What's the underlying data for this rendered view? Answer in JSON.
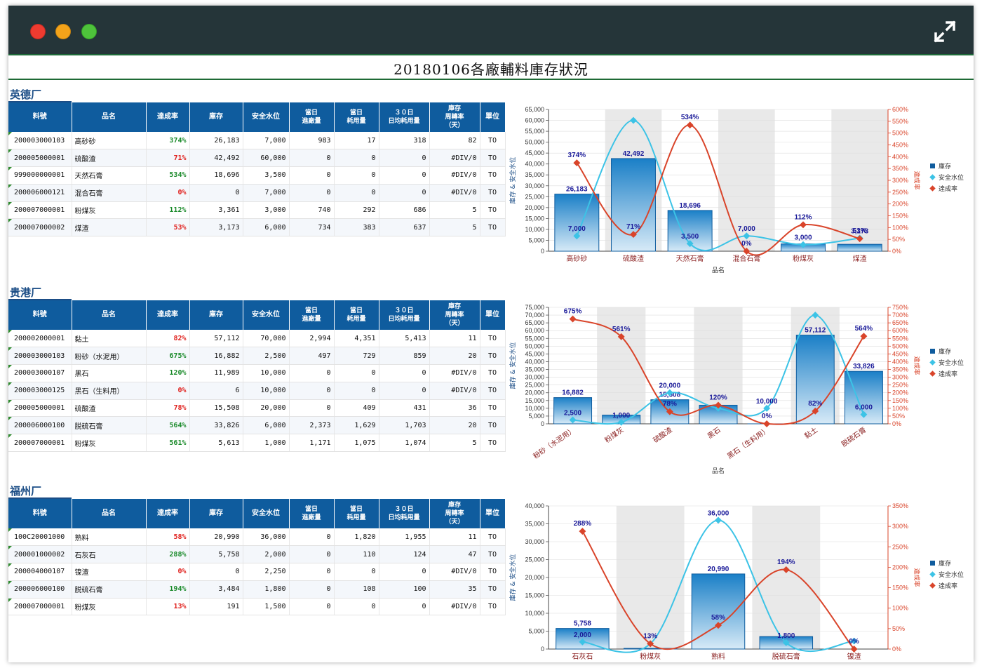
{
  "window": {
    "expand_icon": "expand-arrows-icon"
  },
  "page_title": "20180106各廠輔料庫存狀況",
  "table_headers": [
    "料號",
    "品名",
    "達成率",
    "庫存",
    "安全水位",
    "當日\n進廠量",
    "當日\n耗用量",
    "３０日\n日均耗用量",
    "庫存\n周轉率\n（天）",
    "單位"
  ],
  "colors": {
    "bar": "#1a7fc7",
    "inventory_line": "#3cc3e6",
    "rate_line": "#d9442a",
    "header": "#0f5c9e",
    "good": "#1a8a2a",
    "bad": "#e0201c"
  },
  "plants": [
    {
      "name": "英德厂",
      "rows": [
        {
          "code": "200003000103",
          "name": "高砂砂",
          "rate": "374%",
          "rate_good": true,
          "stock": "26,183",
          "safety": "7,000",
          "in": "983",
          "use": "17",
          "avg": "318",
          "turn": "82",
          "unit": "TO"
        },
        {
          "code": "200005000001",
          "name": "硫酸渣",
          "rate": "71%",
          "rate_good": false,
          "stock": "42,492",
          "safety": "60,000",
          "in": "0",
          "use": "0",
          "avg": "0",
          "turn": "#DIV/0",
          "unit": "TO"
        },
        {
          "code": "999000000001",
          "name": "天然石膏",
          "rate": "534%",
          "rate_good": true,
          "stock": "18,696",
          "safety": "3,500",
          "in": "0",
          "use": "0",
          "avg": "0",
          "turn": "#DIV/0",
          "unit": "TO"
        },
        {
          "code": "200006000121",
          "name": "混合石膏",
          "rate": "0%",
          "rate_good": false,
          "stock": "0",
          "safety": "7,000",
          "in": "0",
          "use": "0",
          "avg": "0",
          "turn": "#DIV/0",
          "unit": "TO"
        },
        {
          "code": "200007000001",
          "name": "粉煤灰",
          "rate": "112%",
          "rate_good": true,
          "stock": "3,361",
          "safety": "3,000",
          "in": "740",
          "use": "292",
          "avg": "686",
          "turn": "5",
          "unit": "TO"
        },
        {
          "code": "200007000002",
          "name": "煤渣",
          "rate": "53%",
          "rate_good": false,
          "stock": "3,173",
          "safety": "6,000",
          "in": "734",
          "use": "383",
          "avg": "637",
          "turn": "5",
          "unit": "TO"
        }
      ]
    },
    {
      "name": "贵港厂",
      "rows": [
        {
          "code": "200002000001",
          "name": "黏土",
          "rate": "82%",
          "rate_good": false,
          "stock": "57,112",
          "safety": "70,000",
          "in": "2,994",
          "use": "4,351",
          "avg": "5,413",
          "turn": "11",
          "unit": "TO"
        },
        {
          "code": "200003000103",
          "name": "粉砂（水泥用）",
          "rate": "675%",
          "rate_good": true,
          "stock": "16,882",
          "safety": "2,500",
          "in": "497",
          "use": "729",
          "avg": "859",
          "turn": "20",
          "unit": "TO"
        },
        {
          "code": "200003000107",
          "name": "黑石",
          "rate": "120%",
          "rate_good": true,
          "stock": "11,989",
          "safety": "10,000",
          "in": "0",
          "use": "0",
          "avg": "0",
          "turn": "#DIV/0",
          "unit": "TO"
        },
        {
          "code": "200003000125",
          "name": "黑石（生料用）",
          "rate": "0%",
          "rate_good": false,
          "stock": "6",
          "safety": "10,000",
          "in": "0",
          "use": "0",
          "avg": "0",
          "turn": "#DIV/0",
          "unit": "TO"
        },
        {
          "code": "200005000001",
          "name": "硫酸渣",
          "rate": "78%",
          "rate_good": false,
          "stock": "15,508",
          "safety": "20,000",
          "in": "0",
          "use": "409",
          "avg": "431",
          "turn": "36",
          "unit": "TO"
        },
        {
          "code": "200006000100",
          "name": "脱硫石膏",
          "rate": "564%",
          "rate_good": true,
          "stock": "33,826",
          "safety": "6,000",
          "in": "2,373",
          "use": "1,629",
          "avg": "1,703",
          "turn": "20",
          "unit": "TO"
        },
        {
          "code": "200007000001",
          "name": "粉煤灰",
          "rate": "561%",
          "rate_good": true,
          "stock": "5,613",
          "safety": "1,000",
          "in": "1,171",
          "use": "1,075",
          "avg": "1,074",
          "turn": "5",
          "unit": "TO"
        }
      ]
    },
    {
      "name": "福州厂",
      "rows": [
        {
          "code": "100C20001000",
          "name": "熟料",
          "rate": "58%",
          "rate_good": false,
          "stock": "20,990",
          "safety": "36,000",
          "in": "0",
          "use": "1,820",
          "avg": "1,955",
          "turn": "11",
          "unit": "TO"
        },
        {
          "code": "200001000002",
          "name": "石灰石",
          "rate": "288%",
          "rate_good": true,
          "stock": "5,758",
          "safety": "2,000",
          "in": "0",
          "use": "110",
          "avg": "124",
          "turn": "47",
          "unit": "TO"
        },
        {
          "code": "200004000107",
          "name": "镍渣",
          "rate": "0%",
          "rate_good": false,
          "stock": "0",
          "safety": "2,250",
          "in": "0",
          "use": "0",
          "avg": "0",
          "turn": "#DIV/0",
          "unit": "TO"
        },
        {
          "code": "200006000100",
          "name": "脱硫石膏",
          "rate": "194%",
          "rate_good": true,
          "stock": "3,484",
          "safety": "1,800",
          "in": "0",
          "use": "108",
          "avg": "100",
          "turn": "35",
          "unit": "TO"
        },
        {
          "code": "200007000001",
          "name": "粉煤灰",
          "rate": "13%",
          "rate_good": false,
          "stock": "191",
          "safety": "1,500",
          "in": "0",
          "use": "0",
          "avg": "0",
          "turn": "#DIV/0",
          "unit": "TO"
        }
      ]
    }
  ],
  "chart_data": [
    {
      "type": "bar",
      "categories": [
        "高砂砂",
        "硫酸渣",
        "天然石膏",
        "混合石膏",
        "粉煤灰",
        "煤渣"
      ],
      "xlabel": "品名",
      "ylabel": "庫存 & 安全水位",
      "y2label": "達成率",
      "ylim": [
        0,
        65000
      ],
      "ystep": 5000,
      "y2lim": [
        0,
        600
      ],
      "y2step": 50,
      "rotate_labels": false,
      "series": [
        {
          "name": "庫存",
          "kind": "bar",
          "values": [
            26183,
            42492,
            18696,
            0,
            3361,
            3173
          ],
          "labels": [
            "26,183",
            "42,492",
            "18,696",
            "",
            "",
            ""
          ]
        },
        {
          "name": "安全水位",
          "kind": "line",
          "values": [
            7000,
            60000,
            3500,
            7000,
            3000,
            6000
          ],
          "labels": [
            "7,000",
            "",
            "3,500",
            "7,000",
            "3,000",
            "3,173"
          ]
        },
        {
          "name": "達成率",
          "kind": "line",
          "axis": "right",
          "values": [
            374,
            71,
            534,
            0,
            112,
            53
          ],
          "labels": [
            "374%",
            "71%",
            "534%",
            "0%",
            "112%",
            "53%"
          ]
        }
      ],
      "legend": [
        "庫存",
        "安全水位",
        "達成率"
      ]
    },
    {
      "type": "bar",
      "categories": [
        "粉砂（水泥用）",
        "粉煤灰",
        "硫酸渣",
        "黑石",
        "黑石（生料用）",
        "黏土",
        "脱硫石膏"
      ],
      "xlabel": "品名",
      "ylabel": "庫存 & 安全水位",
      "y2label": "達成率",
      "ylim": [
        0,
        75000
      ],
      "ystep": 5000,
      "y2lim": [
        0,
        750
      ],
      "y2step": 50,
      "rotate_labels": true,
      "series": [
        {
          "name": "庫存",
          "kind": "bar",
          "values": [
            16882,
            5613,
            15508,
            11989,
            6,
            57112,
            33826
          ],
          "labels": [
            "16,882",
            "",
            "15,508",
            "",
            "",
            "57,112",
            "33,826"
          ]
        },
        {
          "name": "安全水位",
          "kind": "line",
          "values": [
            2500,
            1000,
            20000,
            10000,
            10000,
            70000,
            6000
          ],
          "labels": [
            "2,500",
            "1,000",
            "20,000",
            "",
            "10,000",
            "",
            "6,000"
          ]
        },
        {
          "name": "達成率",
          "kind": "line",
          "axis": "right",
          "values": [
            675,
            561,
            78,
            120,
            0,
            82,
            564
          ],
          "labels": [
            "675%",
            "561%",
            "78%",
            "120%",
            "0%",
            "82%",
            "564%"
          ]
        }
      ],
      "legend": [
        "庫存",
        "安全水位",
        "達成率"
      ]
    },
    {
      "type": "bar",
      "categories": [
        "石灰石",
        "粉煤灰",
        "熟料",
        "脱硫石膏",
        "镍渣"
      ],
      "xlabel": "",
      "ylabel": "庫存 & 安全水位",
      "y2label": "達成率",
      "ylim": [
        0,
        40000
      ],
      "ystep": 5000,
      "y2lim": [
        0,
        350
      ],
      "y2step": 50,
      "rotate_labels": false,
      "series": [
        {
          "name": "庫存",
          "kind": "bar",
          "values": [
            5758,
            191,
            20990,
            3484,
            0
          ],
          "labels": [
            "5,758",
            "",
            "20,990",
            "",
            ""
          ]
        },
        {
          "name": "安全水位",
          "kind": "line",
          "values": [
            2000,
            1500,
            36000,
            1800,
            2250
          ],
          "labels": [
            "2,000",
            "",
            "36,000",
            "1,800",
            ""
          ]
        },
        {
          "name": "達成率",
          "kind": "line",
          "axis": "right",
          "values": [
            288,
            13,
            58,
            194,
            0
          ],
          "labels": [
            "288%",
            "13%",
            "58%",
            "194%",
            "0%"
          ]
        }
      ],
      "legend": [
        "庫存",
        "安全水位",
        "達成率"
      ]
    }
  ]
}
